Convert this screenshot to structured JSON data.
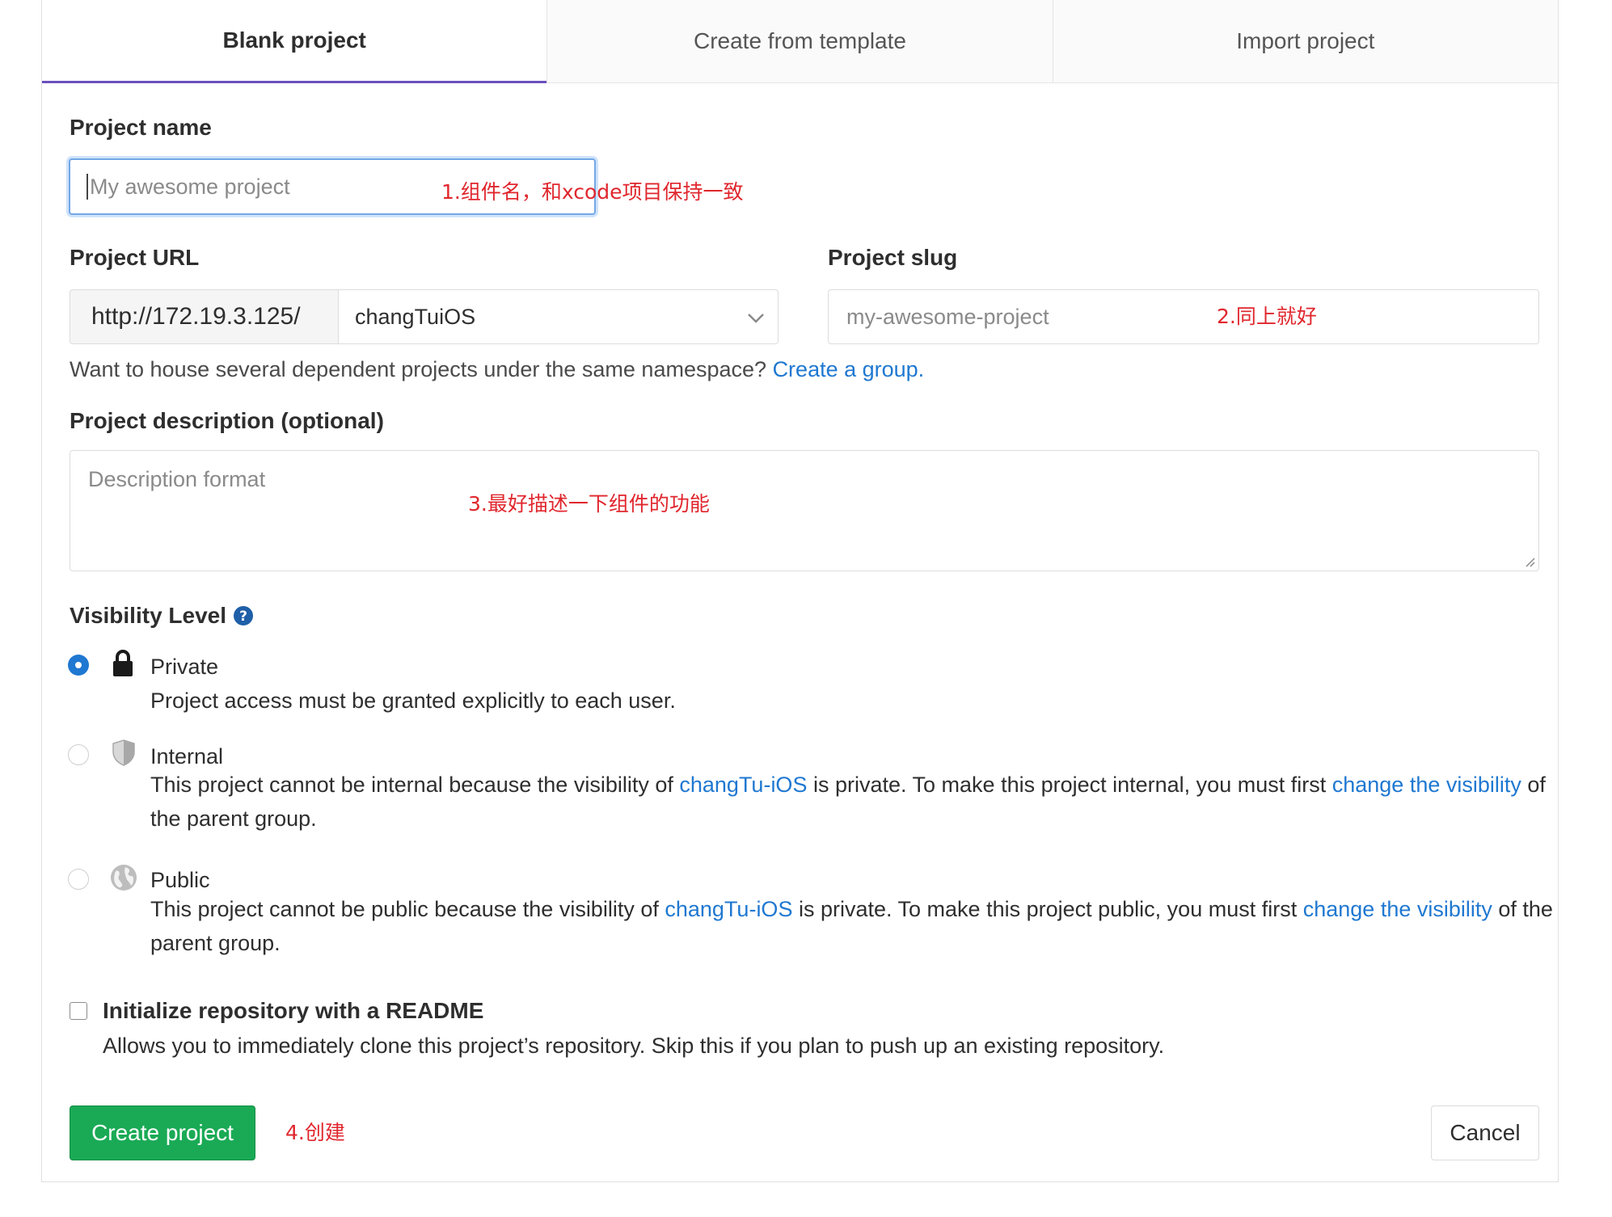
{
  "tabs": [
    {
      "label": "Blank project",
      "active": true
    },
    {
      "label": "Create from template",
      "active": false
    },
    {
      "label": "Import project",
      "active": false
    }
  ],
  "project_name": {
    "label": "Project name",
    "placeholder": "My awesome project",
    "annotation": "1.组件名，和xcode项目保持一致"
  },
  "project_url": {
    "label": "Project URL",
    "prefix": "http://172.19.3.125/",
    "namespace": "changTuiOS"
  },
  "project_slug": {
    "label": "Project slug",
    "placeholder": "my-awesome-project",
    "annotation": "2.同上就好"
  },
  "group_hint": {
    "text": "Want to house several dependent projects under the same namespace?",
    "link": "Create a group."
  },
  "description": {
    "label": "Project description (optional)",
    "placeholder": "Description format",
    "annotation": "3.最好描述一下组件的功能"
  },
  "visibility": {
    "label": "Visibility Level",
    "options": [
      {
        "title": "Private",
        "selected": true,
        "icon": "lock-icon",
        "desc": "Project access must be granted explicitly to each user."
      },
      {
        "title": "Internal",
        "selected": false,
        "icon": "shield-icon",
        "desc_before": "This project cannot be internal because the visibility of",
        "group_link": "changTu-iOS",
        "desc_middle": "is private. To make this project internal, you must first",
        "change_link": "change the visibility",
        "desc_after": "of the parent group."
      },
      {
        "title": "Public",
        "selected": false,
        "icon": "globe-icon",
        "desc_before": "This project cannot be public because the visibility of",
        "group_link": "changTu-iOS",
        "desc_middle": "is private. To make this project public, you must first",
        "change_link": "change the visibility",
        "desc_after": "of the parent group."
      }
    ]
  },
  "readme": {
    "checked": false,
    "label": "Initialize repository with a README",
    "desc": "Allows you to immediately clone this project’s repository. Skip this if you plan to push up an existing repository."
  },
  "actions": {
    "create_label": "Create project",
    "create_annotation": "4.创建",
    "cancel_label": "Cancel"
  },
  "colors": {
    "accent": "#1f78d1",
    "success": "#1aaa55",
    "tab_underline": "#6b4fbb",
    "annotation": "#e0262d"
  }
}
